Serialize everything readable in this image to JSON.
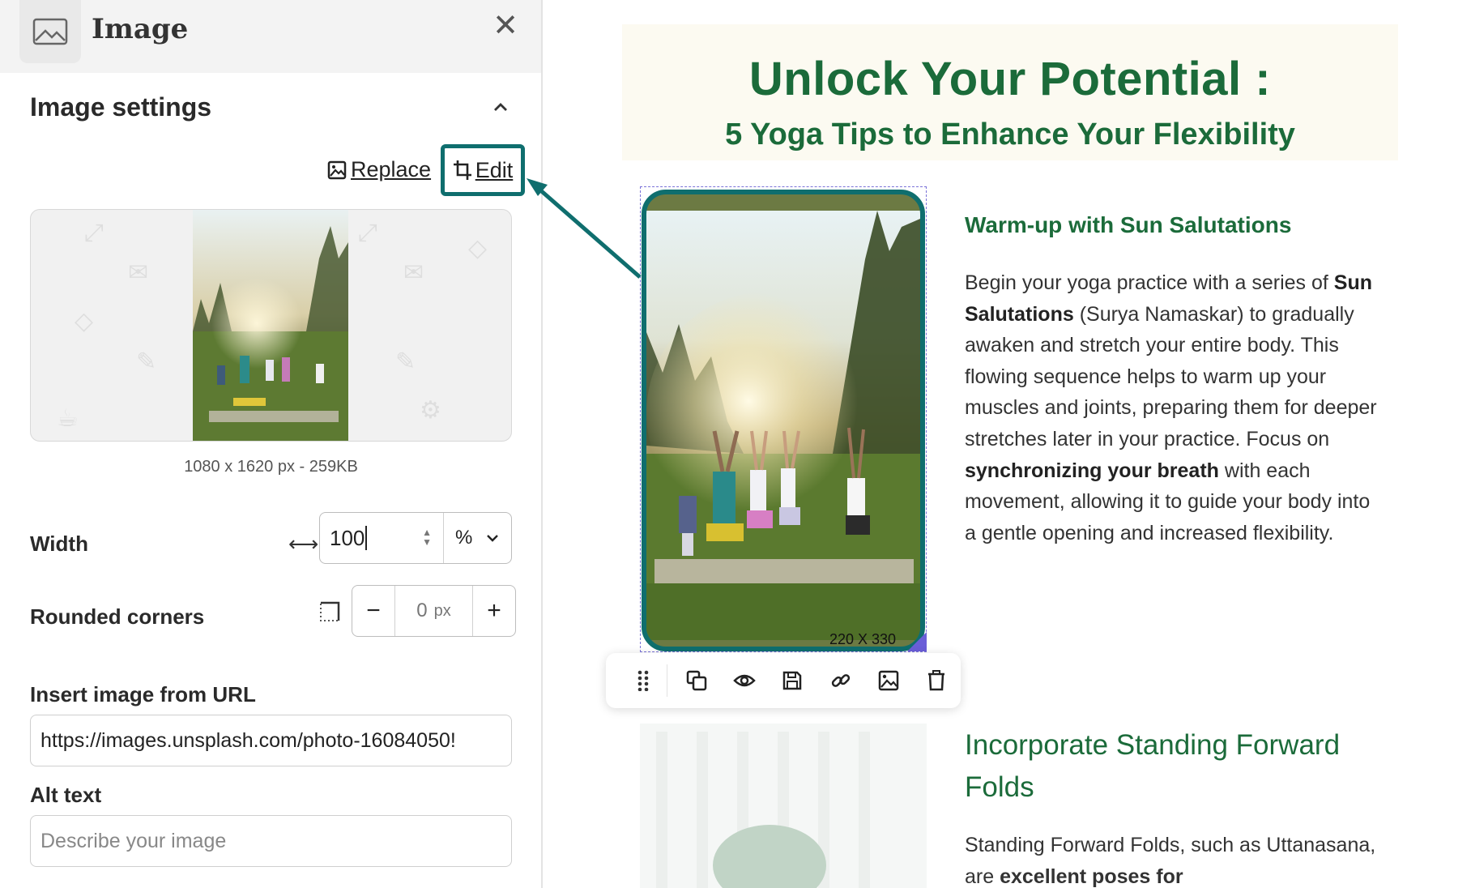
{
  "panel": {
    "title": "Image",
    "section_title": "Image settings",
    "replace_label": "Replace",
    "edit_label": "Edit",
    "file_meta": "1080 x 1620 px - 259KB",
    "width": {
      "label": "Width",
      "value": "100",
      "unit": "%"
    },
    "rounded_corners": {
      "label": "Rounded corners",
      "value": "0",
      "unit": "px",
      "minus": "−",
      "plus": "+"
    },
    "url": {
      "label": "Insert image from URL",
      "value": "https://images.unsplash.com/photo-16084050!"
    },
    "alt": {
      "label": "Alt text",
      "placeholder": "Describe your image"
    }
  },
  "canvas": {
    "title": "Unlock Your Potential :",
    "subtitle": "5 Yoga Tips to Enhance Your Flexibility",
    "image_dims": "220 X 330",
    "section1": {
      "heading": "Warm-up with Sun Salutations",
      "text_a": "Begin your yoga practice with a series of ",
      "bold_a": "Sun Salutations",
      "text_b": " (Surya Namaskar) to gradually awaken and stretch your entire body. This flowing sequence helps to warm up your muscles and joints, preparing them for deeper stretches later in your practice. Focus on ",
      "bold_b": "synchronizing your breath",
      "text_c": " with each movement, allowing it to guide your body into a gentle opening and increased flexibility."
    },
    "section2": {
      "heading": "Incorporate Standing Forward Folds",
      "text_a": "Standing Forward Folds, such as Uttanasana, are ",
      "bold_a": "excellent poses for"
    }
  },
  "toolbar_icons": [
    "drag-handle-icon",
    "duplicate-icon",
    "preview-icon",
    "save-icon",
    "link-icon",
    "image-icon",
    "delete-icon"
  ],
  "colors": {
    "accent": "#0f6e6e",
    "heading_green": "#1b6b3a",
    "selection": "#6a5ed8",
    "hero_bg": "#fcfaf1"
  }
}
